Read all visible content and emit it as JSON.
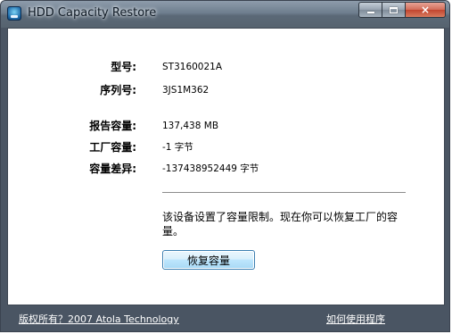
{
  "window": {
    "title": "HDD Capacity Restore",
    "icon": "hdd-app-icon",
    "controls": {
      "minimize": "minimize-icon",
      "maximize": "maximize-icon",
      "close": "×"
    }
  },
  "drive_info": [
    {
      "label": "型号:",
      "value": "ST3160021A"
    },
    {
      "label": "序列号:",
      "value": "3JS1M362"
    }
  ],
  "capacity_info": [
    {
      "label": "报告容量:",
      "value": "137,438 MB"
    },
    {
      "label": "工厂容量:",
      "value": "-1 字节"
    },
    {
      "label": "容量差异:",
      "value": "-137438952449 字节"
    }
  ],
  "message": "该设备设置了容量限制。现在你可以恢复工厂的容量。",
  "restore_button": "恢复容量",
  "footer": {
    "copyright_link": "版权所有？2007 Atola Technology",
    "help_link": "如何使用程序"
  },
  "colors": {
    "frame": "#4a5563",
    "button_border": "#3c7fb1",
    "close_button": "#c2452f"
  }
}
